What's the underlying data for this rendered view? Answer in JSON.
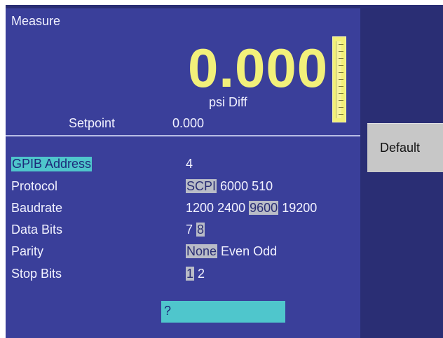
{
  "measure": {
    "title": "Measure",
    "value": "0.000",
    "unit": "psi Diff",
    "setpoint_label": "Setpoint",
    "setpoint_value": "0.000"
  },
  "settings": {
    "gpib_address": {
      "label": "GPIB Address",
      "value": "4"
    },
    "protocol": {
      "label": "Protocol",
      "options": [
        "SCPI",
        "6000",
        "510"
      ],
      "selected": "SCPI"
    },
    "baudrate": {
      "label": "Baudrate",
      "options": [
        "1200",
        "2400",
        "9600",
        "19200"
      ],
      "selected": "9600"
    },
    "data_bits": {
      "label": "Data Bits",
      "options": [
        "7",
        "8"
      ],
      "selected": "8"
    },
    "parity": {
      "label": "Parity",
      "options": [
        "None",
        "Even",
        "Odd"
      ],
      "selected": "None"
    },
    "stop_bits": {
      "label": "Stop Bits",
      "options": [
        "1",
        "2"
      ],
      "selected": "1"
    }
  },
  "help_input": {
    "text": "?"
  },
  "sidebar": {
    "default_label": "Default"
  },
  "colors": {
    "panel": "#3a3f9a",
    "accent_yellow": "#f2f07a",
    "cyan_highlight": "#4fc6cc",
    "gray_highlight": "#b9bcc7"
  }
}
